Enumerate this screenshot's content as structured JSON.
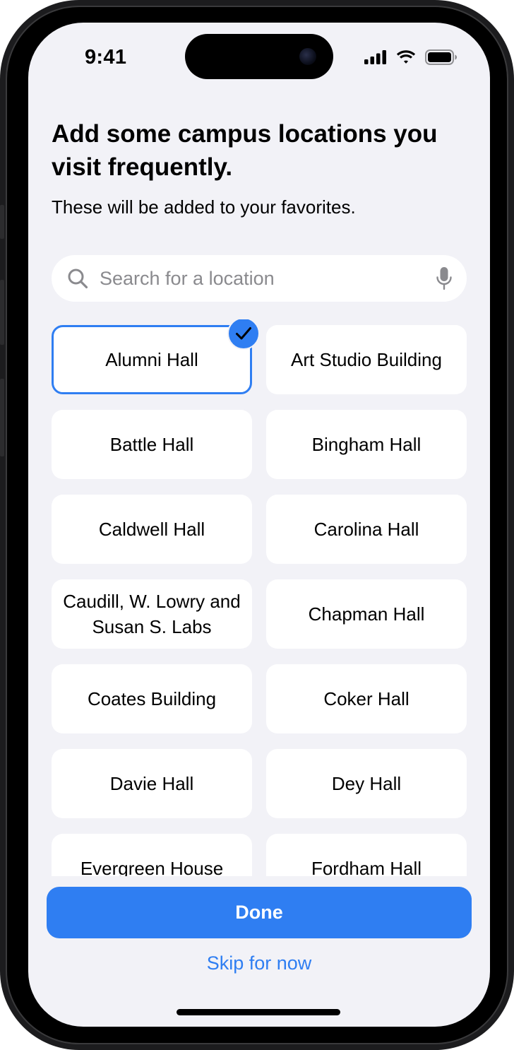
{
  "status_bar": {
    "time": "9:41"
  },
  "header": {
    "title": "Add some campus locations you visit frequently.",
    "subtitle": "These will be added to your favorites."
  },
  "search": {
    "placeholder": "Search for a location",
    "value": ""
  },
  "locations": [
    {
      "label": "Alumni Hall",
      "selected": true
    },
    {
      "label": "Art Studio Building",
      "selected": false
    },
    {
      "label": "Battle Hall",
      "selected": false
    },
    {
      "label": "Bingham Hall",
      "selected": false
    },
    {
      "label": "Caldwell Hall",
      "selected": false
    },
    {
      "label": "Carolina Hall",
      "selected": false
    },
    {
      "label": "Caudill, W. Lowry and Susan S. Labs",
      "selected": false
    },
    {
      "label": "Chapman Hall",
      "selected": false
    },
    {
      "label": "Coates Building",
      "selected": false
    },
    {
      "label": "Coker Hall",
      "selected": false
    },
    {
      "label": "Davie Hall",
      "selected": false
    },
    {
      "label": "Dey Hall",
      "selected": false
    },
    {
      "label": "Evergreen House",
      "selected": false
    },
    {
      "label": "Fordham Hall",
      "selected": false
    }
  ],
  "actions": {
    "done_label": "Done",
    "skip_label": "Skip for now"
  },
  "colors": {
    "accent": "#2f7ef2",
    "background": "#f2f2f7",
    "tile": "#ffffff"
  },
  "icons": {
    "search": "magnifying-glass-icon",
    "mic": "microphone-icon",
    "check": "checkmark-icon",
    "signal": "cellular-signal-icon",
    "wifi": "wifi-icon",
    "battery": "battery-icon"
  }
}
